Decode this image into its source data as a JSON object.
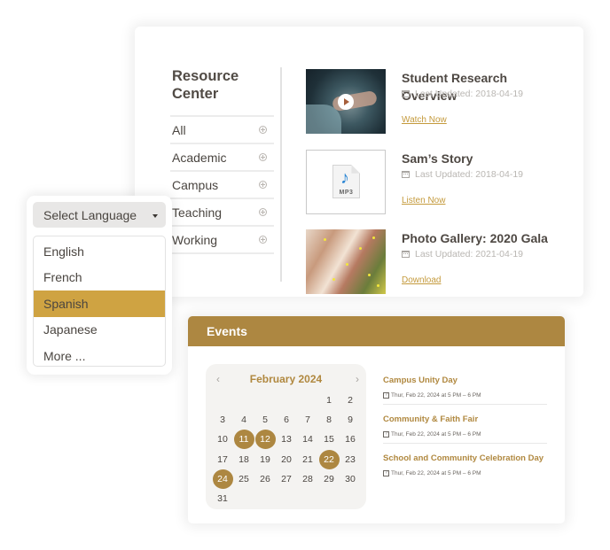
{
  "resource_center": {
    "title": "Resource Center",
    "nav": [
      {
        "label": "All",
        "icon": "plus-circle-icon"
      },
      {
        "label": "Academic",
        "icon": "plus-circle-icon"
      },
      {
        "label": "Campus",
        "icon": "plus-circle-icon"
      },
      {
        "label": "Teaching",
        "icon": "plus-circle-icon"
      },
      {
        "label": "Working",
        "icon": "plus-circle-icon"
      }
    ],
    "items": [
      {
        "title": "Student Research Overview",
        "meta": "Last Updated: 2018-04-19",
        "link": "Watch Now",
        "thumb": "video-thumbnail"
      },
      {
        "title": "Sam’s Story",
        "meta": "Last Updated: 2018-04-19",
        "link": "Listen Now",
        "thumb": "mp3-file-icon",
        "thumb_label": "MP3"
      },
      {
        "title": "Photo Gallery: 2020 Gala",
        "meta": "Last Updated: 2021-04-19",
        "link": "Download",
        "thumb": "photo-thumbnail"
      }
    ]
  },
  "language": {
    "select_label": "Select Language",
    "options": [
      "English",
      "French",
      "Spanish",
      "Japanese",
      "More ..."
    ],
    "selected": "Spanish"
  },
  "events": {
    "header": "Events",
    "calendar": {
      "month_label": "February 2024",
      "prev": "‹",
      "next": "›",
      "leading_blanks": 5,
      "days_in_month": 31,
      "event_days": [
        11,
        12,
        22,
        24
      ]
    },
    "list": [
      {
        "title": "Campus Unity Day",
        "time": "Thur, Feb 22, 2024 at 5 PM – 6 PM"
      },
      {
        "title": "Community & Faith Fair",
        "time": "Thur, Feb 22, 2024 at 5 PM – 6 PM"
      },
      {
        "title": "School and Community Celebration Day",
        "time": "Thur, Feb 22, 2024 at 5 PM – 6 PM"
      }
    ]
  },
  "colors": {
    "accent_gold": "#ad8741",
    "link_gold": "#c49a3c",
    "selected_option": "#cfa342"
  }
}
